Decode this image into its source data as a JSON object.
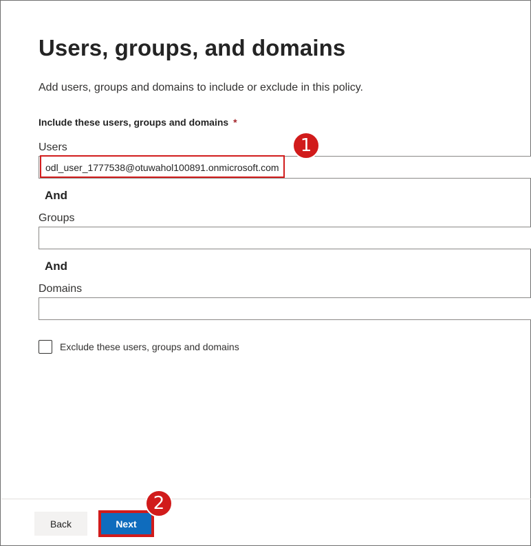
{
  "page": {
    "title": "Users, groups, and domains",
    "subtitle": "Add users, groups and domains to include or exclude in this policy."
  },
  "include_section": {
    "label": "Include these users, groups and domains",
    "required_marker": "*",
    "users": {
      "label": "Users",
      "value": "odl_user_1777538@otuwahol100891.onmicrosoft.com"
    },
    "and_1": "And",
    "groups": {
      "label": "Groups",
      "value": ""
    },
    "and_2": "And",
    "domains": {
      "label": "Domains",
      "value": ""
    }
  },
  "exclude": {
    "label": "Exclude these users, groups and domains",
    "checked": false
  },
  "footer": {
    "back_label": "Back",
    "next_label": "Next"
  },
  "annotations": {
    "step1": "1",
    "step2": "2"
  },
  "colors": {
    "primary": "#0f6cbd",
    "annotation": "#d11b1b",
    "required": "#a4262c"
  }
}
